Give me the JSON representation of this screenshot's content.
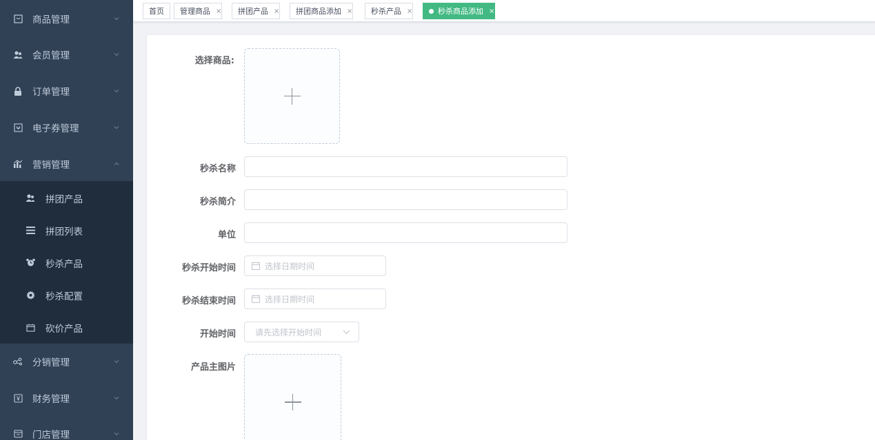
{
  "sidebar": {
    "menu": [
      {
        "label": "商品管理",
        "icon": "goods-icon"
      },
      {
        "label": "会员管理",
        "icon": "users-icon"
      },
      {
        "label": "订单管理",
        "icon": "lock-icon"
      },
      {
        "label": "电子券管理",
        "icon": "coupon-icon"
      },
      {
        "label": "营销管理",
        "icon": "chart-icon"
      },
      {
        "label": "分销管理",
        "icon": "share-icon"
      },
      {
        "label": "财务管理",
        "icon": "finance-icon"
      },
      {
        "label": "门店管理",
        "icon": "store-icon"
      }
    ],
    "submenu": [
      {
        "label": "拼团产品",
        "icon": "group-icon"
      },
      {
        "label": "拼团列表",
        "icon": "list-icon"
      },
      {
        "label": "秒杀产品",
        "icon": "alarm-icon"
      },
      {
        "label": "秒杀配置",
        "icon": "gear-icon"
      },
      {
        "label": "砍价产品",
        "icon": "box-icon"
      }
    ]
  },
  "tags": [
    {
      "label": "首页",
      "closable": false
    },
    {
      "label": "管理商品",
      "closable": true
    },
    {
      "label": "拼团产品",
      "closable": true
    },
    {
      "label": "拼团商品添加",
      "closable": true
    },
    {
      "label": "秒杀产品",
      "closable": true
    },
    {
      "label": "秒杀商品添加",
      "closable": true,
      "active": true
    }
  ],
  "tag_close_glyph": "×",
  "form": {
    "select_goods_label": "选择商品:",
    "name_label": "秒杀名称",
    "intro_label": "秒杀简介",
    "unit_label": "单位",
    "start_time_label": "秒杀开始时间",
    "end_time_label": "秒杀结束时间",
    "begin_label": "开始时间",
    "main_image_label": "产品主图片",
    "date_placeholder": "选择日期时间",
    "begin_placeholder": "请先选择开始时间",
    "name_value": "",
    "intro_value": "",
    "unit_value": ""
  },
  "colors": {
    "sidebar_bg": "#304156",
    "submenu_bg": "#1f2d3d",
    "menu_text": "#bfcbd9",
    "active_tag": "#42b983"
  }
}
